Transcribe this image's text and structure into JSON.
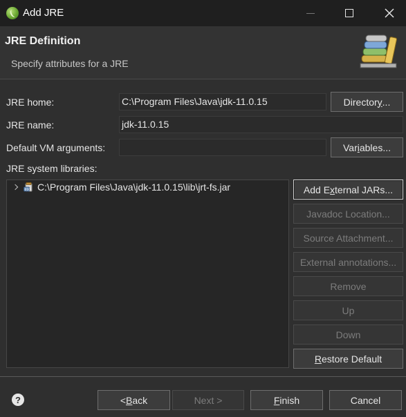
{
  "window": {
    "title": "Add JRE"
  },
  "header": {
    "title": "JRE Definition",
    "subtitle": "Specify attributes for a JRE"
  },
  "form": {
    "jre_home_label": "JRE home:",
    "jre_home_value": "C:\\Program Files\\Java\\jdk-11.0.15",
    "directory_button_pre": "Director",
    "directory_button_key": "y",
    "directory_button_post": "...",
    "jre_name_label": "JRE name:",
    "jre_name_value": "jdk-11.0.15",
    "vm_args_label": "Default VM arguments:",
    "vm_args_value": "",
    "variables_button_pre": "Var",
    "variables_button_key": "i",
    "variables_button_post": "ables...",
    "libraries_label": "JRE system libraries:"
  },
  "libraries": {
    "items": [
      {
        "path": "C:\\Program Files\\Java\\jdk-11.0.15\\lib\\jrt-fs.jar"
      }
    ]
  },
  "library_buttons": {
    "add_external_pre": "Add E",
    "add_external_key": "x",
    "add_external_post": "ternal JARs...",
    "javadoc": "Javadoc Location...",
    "source": "Source Attachment...",
    "annotations": "External annotations...",
    "remove": "Remove",
    "up": "Up",
    "down": "Down",
    "restore_key": "R",
    "restore_post": "estore Default"
  },
  "footer": {
    "back_pre": "< ",
    "back_key": "B",
    "back_post": "ack",
    "next": "Next >",
    "finish_key": "F",
    "finish_post": "inish",
    "cancel": "Cancel"
  }
}
